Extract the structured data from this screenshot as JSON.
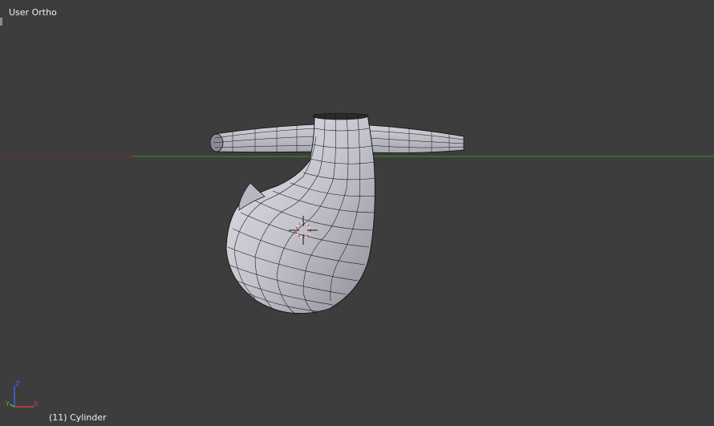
{
  "viewport": {
    "view_name": "User Ortho",
    "object_info": "(11) Cylinder"
  },
  "axes": {
    "x_label": "X",
    "y_label": "Y",
    "z_label": "Z",
    "x_color": "#d04040",
    "y_color": "#40c040",
    "z_color": "#4060ff"
  },
  "colors": {
    "background": "#3d3d3d",
    "grid_x_axis": "#7a2a2a",
    "grid_y_axis": "#3a8a2a",
    "mesh_fill": "#c8c8d0",
    "mesh_wire": "#000000",
    "cursor": "#c03030"
  },
  "icons": [
    "3d-cursor-icon",
    "axis-gizmo-icon"
  ]
}
